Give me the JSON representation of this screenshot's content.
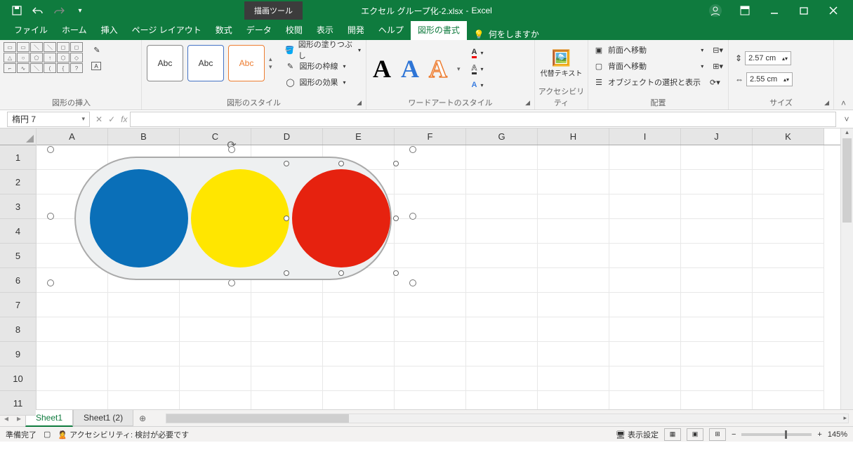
{
  "title": {
    "filename": "エクセル グループ化-2.xlsx",
    "app": "Excel",
    "contextTab": "描画ツール"
  },
  "tabs": {
    "file": "ファイル",
    "home": "ホーム",
    "insert": "挿入",
    "layout": "ページ レイアウト",
    "formulas": "数式",
    "data": "データ",
    "review": "校閲",
    "view": "表示",
    "dev": "開発",
    "help": "ヘルプ",
    "format": "図形の書式",
    "tellme": "何をしますか"
  },
  "ribbon": {
    "insertShapes": "図形の挿入",
    "shapeStyles": "図形のスタイル",
    "abc": "Abc",
    "fill": "図形の塗りつぶし",
    "outline": "図形の枠線",
    "effects": "図形の効果",
    "wordart": "ワードアートのスタイル",
    "altText": "代替テキスト",
    "altGroup": "アクセシビリティ",
    "bringFwd": "前面へ移動",
    "sendBack": "背面へ移動",
    "selPane": "オブジェクトの選択と表示",
    "arrange": "配置",
    "sizeH": "2.57 cm",
    "sizeW": "2.55 cm",
    "size": "サイズ"
  },
  "namebox": "楕円 7",
  "fx": "fx",
  "cols": [
    "A",
    "B",
    "C",
    "D",
    "E",
    "F",
    "G",
    "H",
    "I",
    "J",
    "K"
  ],
  "rows": [
    "1",
    "2",
    "3",
    "4",
    "5",
    "6",
    "7",
    "8",
    "9",
    "10",
    "11"
  ],
  "sheets": {
    "s1": "Sheet1",
    "s2": "Sheet1 (2)"
  },
  "status": {
    "ready": "準備完了",
    "a11y": "アクセシビリティ: 検討が必要です",
    "display": "表示設定",
    "zoom": "145%"
  }
}
